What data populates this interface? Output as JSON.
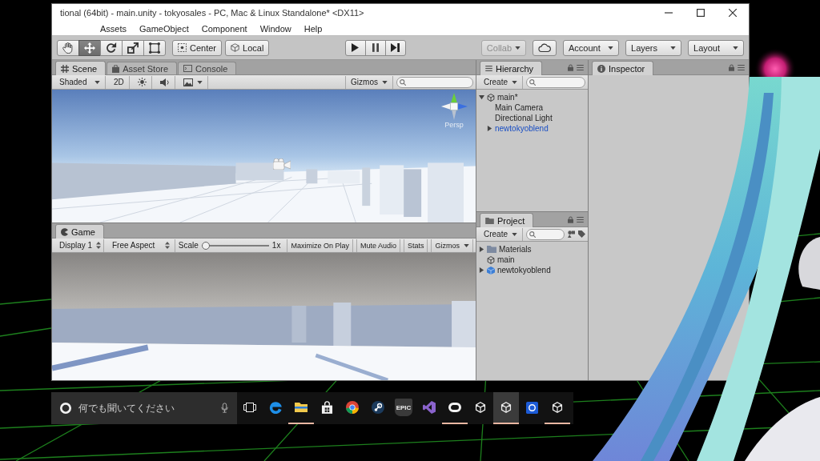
{
  "window": {
    "title": "tional (64bit) - main.unity - tokyosales - PC, Mac & Linux Standalone* <DX11>"
  },
  "menu": [
    "Assets",
    "GameObject",
    "Component",
    "Window",
    "Help"
  ],
  "toolbar": {
    "tools": [
      {
        "kind": "hand",
        "selected": false
      },
      {
        "kind": "move",
        "selected": true
      },
      {
        "kind": "rotate",
        "selected": false
      },
      {
        "kind": "scale",
        "selected": false
      },
      {
        "kind": "rect",
        "selected": false
      }
    ],
    "pivot": [
      {
        "kind": "center",
        "label": "Center"
      },
      {
        "kind": "local",
        "label": "Local"
      }
    ],
    "collab": {
      "label": "Collab",
      "disabled": true
    },
    "account": "Account",
    "layers": "Layers",
    "layout": "Layout"
  },
  "scene_panel": {
    "tabs": [
      {
        "kind": "scene",
        "label": "Scene",
        "selected": true
      },
      {
        "kind": "store",
        "label": "Asset Store",
        "selected": false
      },
      {
        "kind": "console",
        "label": "Console",
        "selected": false
      }
    ],
    "shading": "Shaded",
    "mode_2d": {
      "label": "2D",
      "on": false
    },
    "lighting": {
      "on": false
    },
    "audio": {
      "on": false
    },
    "gizmos": "Gizmos",
    "persp_label": "Persp"
  },
  "hierarchy": {
    "tab": "Hierarchy",
    "create": "Create",
    "items": [
      {
        "label": "main*",
        "kind": "scene",
        "expanded": true,
        "children": [
          {
            "label": "Main Camera",
            "kind": "object"
          },
          {
            "label": "Directional Light",
            "kind": "object"
          },
          {
            "label": "newtokyoblend",
            "kind": "prefab",
            "expanded": false
          }
        ]
      }
    ]
  },
  "project": {
    "tab": "Project",
    "create": "Create",
    "items": [
      {
        "label": "Materials",
        "kind": "folder",
        "expanded": false
      },
      {
        "label": "main",
        "kind": "scene"
      },
      {
        "label": "newtokyoblend",
        "kind": "model",
        "expanded": false
      }
    ]
  },
  "inspector": {
    "tab": "Inspector"
  },
  "game_panel": {
    "tab": "Game",
    "display": "Display 1",
    "aspect": "Free Aspect",
    "scale_label": "Scale",
    "scale": {
      "level": 0
    },
    "scale_reading": "1x",
    "toggles": [
      {
        "label": "Maximize On Play",
        "on": false
      },
      {
        "label": "Mute Audio",
        "on": false
      },
      {
        "label": "Stats",
        "on": false
      }
    ],
    "gizmos": "Gizmos"
  },
  "taskbar": {
    "search": {
      "placeholder": "何でも聞いてください"
    },
    "apps": [
      {
        "kind": "edge",
        "running": false,
        "selected": false
      },
      {
        "kind": "explorer",
        "running": true,
        "selected": false
      },
      {
        "kind": "store",
        "running": false,
        "selected": false
      },
      {
        "kind": "chrome",
        "running": false,
        "selected": false
      },
      {
        "kind": "steam",
        "running": false,
        "selected": false
      },
      {
        "kind": "epic",
        "label": "EPIC",
        "running": false,
        "selected": false
      },
      {
        "kind": "vs",
        "running": false,
        "selected": false
      },
      {
        "kind": "oculus",
        "running": true,
        "selected": false
      },
      {
        "kind": "unity",
        "running": false,
        "selected": false
      },
      {
        "kind": "unity",
        "running": true,
        "selected": true
      },
      {
        "kind": "tile",
        "running": false,
        "selected": false
      },
      {
        "kind": "unity",
        "running": true,
        "selected": false
      }
    ]
  }
}
